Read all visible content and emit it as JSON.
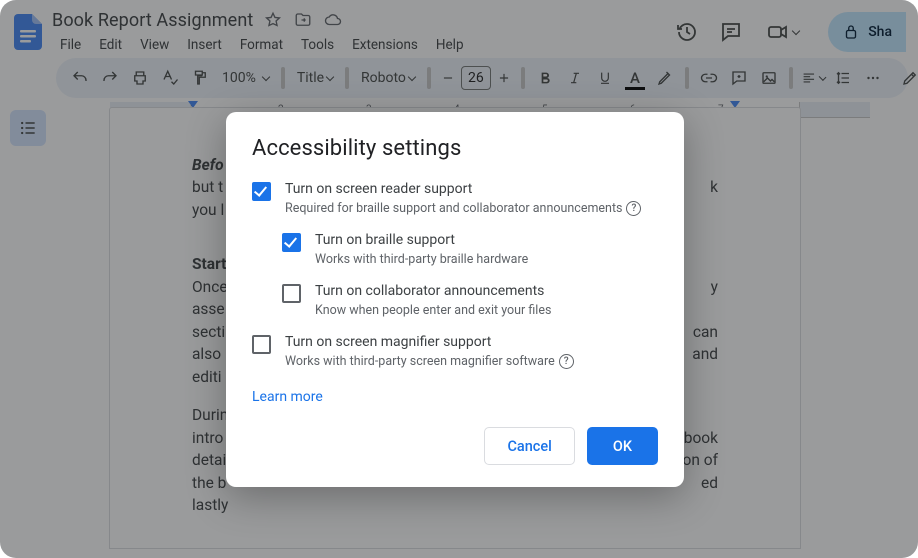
{
  "header": {
    "doc_title": "Book Report Assignment",
    "menus": [
      "File",
      "Edit",
      "View",
      "Insert",
      "Format",
      "Tools",
      "Extensions",
      "Help"
    ],
    "share_label": "Sha"
  },
  "toolbar": {
    "zoom": "100%",
    "style": "Title",
    "font": "Roboto",
    "font_size": "26",
    "text_color_letter": "A"
  },
  "ruler": {
    "numbers": [
      "1",
      "2",
      "3",
      "4",
      "5",
      "6",
      "7"
    ]
  },
  "document": {
    "p1_b": "Befo",
    "p1_l2a": "but t",
    "p1_l2b": "k",
    "p1_l3": "you l",
    "p2_b": "Start",
    "p2_l1": "Once",
    "p2_l1b": "y",
    "p2_l2": "asse",
    "p2_l3a": "secti",
    "p2_l3b": "can",
    "p2_l4a": "also",
    "p2_l4b": "and",
    "p2_l5": "editi",
    "p3_l1": "Durin",
    "p3_l2a": "intro",
    "p3_l2b": "book",
    "p3_l3a": "detai",
    "p3_l3b": "on of",
    "p3_l4a": "the b",
    "p3_l4b": "ed",
    "p3_l5": "lastly"
  },
  "modal": {
    "title": "Accessibility settings",
    "opt1_label": "Turn on screen reader support",
    "opt1_sub": "Required for braille support and collaborator announcements",
    "opt2_label": "Turn on braille support",
    "opt2_sub": "Works with third-party braille hardware",
    "opt3_label": "Turn on collaborator announcements",
    "opt3_sub": "Know when people enter and exit your files",
    "opt4_label": "Turn on screen magnifier support",
    "opt4_sub": "Works with third-party screen magnifier software",
    "learn_more": "Learn more",
    "cancel": "Cancel",
    "ok": "OK",
    "help_glyph": "?"
  }
}
